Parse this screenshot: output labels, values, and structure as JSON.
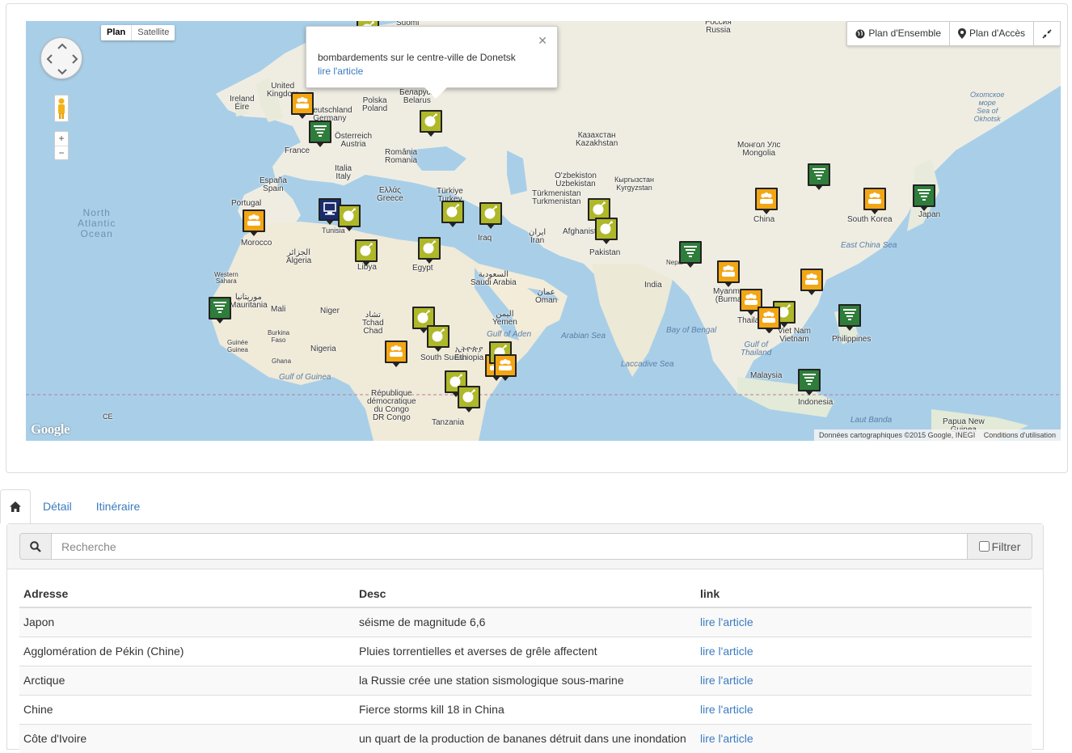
{
  "map": {
    "maptype": {
      "plan": "Plan",
      "satellite": "Satellite"
    },
    "buttons": {
      "overview": "Plan d'Ensemble",
      "access": "Plan d'Accès"
    },
    "popup": {
      "desc": "bombardements sur le centre-ville de Donetsk",
      "link": "lire l'article"
    },
    "attribution": {
      "data": "Données cartographiques ©2015 Google, INEGI",
      "terms": "Conditions d'utilisation"
    },
    "logo": "Google",
    "labels": {
      "suomi": "Suomi",
      "russia": "Россия\nRussia",
      "uk": "United\nKingdom",
      "ireland": "Ireland\nÉire",
      "poland": "Polska\nPoland",
      "belarus": "Беларусь\nBelarus",
      "germany": "Deutschland\nGermany",
      "austria": "Österreich\nAustria",
      "france": "France",
      "romania": "România\nRomania",
      "kazakhstan": "Казахстан\nKazakhstan",
      "mongolia": "Монгол Улс\nMongolia",
      "okhotsk": "Охотское\nморе\nSea of\nOkhotsk",
      "italy": "Italia\nItaly",
      "spain": "España\nSpain",
      "portugal": "Portugal",
      "greece": "Ελλάς\nGreece",
      "turkey": "Türkiye\nTurkey",
      "uzbekistan": "O'zbekiston\nUzbekistan",
      "kyrgyzstan": "Кыргызстан\nKyrgyzstan",
      "turkmenistan": "Türkmenistan\nTurkmenistan",
      "china": "China",
      "south_korea": "South Korea",
      "japan": "Japan",
      "east_china_sea": "East China Sea",
      "morocco": "Morocco",
      "algeria": "الجزائر\nAlgeria",
      "libya": "Libya",
      "egypt": "Egypt",
      "iraq": "Iraq",
      "iran": "ایران\nIran",
      "afghanistan": "Afghanistan",
      "pakistan": "Pakistan",
      "saudi": "السعودية\nSaudi Arabia",
      "oman": "عمان\nOman",
      "india": "India",
      "myanmar": "Myanmar\n(Burma)",
      "western_sahara": "Western\nSahara",
      "mauritania": "موريتانيا\nMauritania",
      "mali": "Mali",
      "niger": "Niger",
      "chad": "تشاد\nTchad\nChad",
      "sudan": "South Sudan",
      "ethiopia": "ኢትዮጵያ\nEthiopia",
      "yemen": "اليمن\nYemen",
      "gulf_aden": "Gulf of Aden",
      "arabian_sea": "Arabian Sea",
      "bay_bengal": "Bay of Bengal",
      "thailand": "Thailand",
      "vietnam": "Viet Nam\nVietnam",
      "philippines": "Philippines",
      "gulf_thailand": "Gulf of\nThailand",
      "laccadive": "Laccadive Sea",
      "malaysia": "Malaysia",
      "indonesia": "Indonesia",
      "nigeria": "Nigeria",
      "burkina": "Burkina\nFaso",
      "ghana": "Ghana",
      "guinea": "Guinée\nGuinea",
      "gulf_guinea": "Gulf of Guinea",
      "congo": "République\ndémocratique\ndu Congo\nDR Congo",
      "tanzania": "Tanzania",
      "banda": "Laut Banda",
      "png": "Papua New\nGuinea",
      "atlantic": "North\nAtlantic\nOcean",
      "ce": "CE",
      "tunisia": "Tunisia",
      "nepal": "Nepal"
    }
  },
  "tabs": {
    "detail": "Détail",
    "itinerary": "Itinéraire"
  },
  "search": {
    "placeholder": "Recherche",
    "filter": "Filtrer"
  },
  "table": {
    "headers": {
      "address": "Adresse",
      "desc": "Desc",
      "link": "link"
    },
    "rows": [
      {
        "address": "Japon",
        "desc": "séisme de magnitude 6,6",
        "link": "lire l'article"
      },
      {
        "address": "Agglomération de Pékin (Chine)",
        "desc": "Pluies torrentielles et averses de grêle affectent",
        "link": "lire l'article"
      },
      {
        "address": "Arctique",
        "desc": "la Russie crée une station sismologique sous-marine",
        "link": "lire l'article"
      },
      {
        "address": "Chine",
        "desc": "Fierce storms kill 18 in China",
        "link": "lire l'article"
      },
      {
        "address": "Côte d'Ivoire",
        "desc": "un quart de la production de bananes détruit dans une inondation",
        "link": "lire l'article"
      }
    ]
  },
  "markers": [
    {
      "type": "protest"
    },
    {
      "type": "storm"
    },
    {
      "type": "bomb"
    },
    {
      "type": "protest"
    },
    {
      "type": "cyber"
    },
    {
      "type": "bomb"
    },
    {
      "type": "bomb"
    },
    {
      "type": "bomb"
    },
    {
      "type": "bomb"
    },
    {
      "type": "bomb"
    },
    {
      "type": "bomb"
    },
    {
      "type": "bomb"
    },
    {
      "type": "storm"
    },
    {
      "type": "protest"
    },
    {
      "type": "bomb"
    },
    {
      "type": "bomb"
    },
    {
      "type": "protest"
    },
    {
      "type": "bomb"
    },
    {
      "type": "bomb"
    },
    {
      "type": "protest"
    },
    {
      "type": "bomb"
    },
    {
      "type": "bomb"
    },
    {
      "type": "storm"
    },
    {
      "type": "protest"
    },
    {
      "type": "storm"
    },
    {
      "type": "protest"
    },
    {
      "type": "storm"
    },
    {
      "type": "protest"
    },
    {
      "type": "protest"
    },
    {
      "type": "protest"
    },
    {
      "type": "bomb"
    },
    {
      "type": "protest"
    },
    {
      "type": "storm"
    },
    {
      "type": "storm"
    },
    {
      "type": "protest"
    }
  ],
  "colors": {
    "protest": "#f3a614",
    "bomb": "#aeb829",
    "storm": "#2e7d3a",
    "cyber": "#1a2b6e",
    "link": "#3b7bbf",
    "water": "#a9cfe8",
    "land": "#f1eee4"
  }
}
